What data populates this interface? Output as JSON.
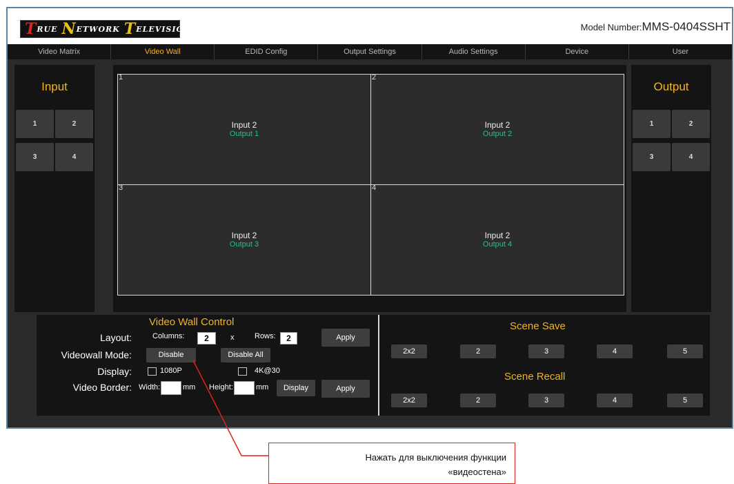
{
  "header": {
    "logo_text": "True Network Television",
    "model_label": "Model Number:",
    "model_value": "MMS-0404SSHT"
  },
  "nav": {
    "tabs": [
      {
        "label": "Video Matrix",
        "active": false
      },
      {
        "label": "Video Wall",
        "active": true
      },
      {
        "label": "EDID Config",
        "active": false
      },
      {
        "label": "Output Settings",
        "active": false
      },
      {
        "label": "Audio Settings",
        "active": false
      },
      {
        "label": "Device",
        "active": false
      },
      {
        "label": "User",
        "active": false
      }
    ]
  },
  "input_panel": {
    "title": "Input",
    "buttons": [
      "1",
      "2",
      "3",
      "4"
    ]
  },
  "output_panel": {
    "title": "Output",
    "buttons": [
      "1",
      "2",
      "3",
      "4"
    ]
  },
  "wall": {
    "cells": [
      {
        "number": "1",
        "input": "Input 2",
        "output": "Output 1"
      },
      {
        "number": "2",
        "input": "Input 2",
        "output": "Output 2"
      },
      {
        "number": "3",
        "input": "Input 2",
        "output": "Output 3"
      },
      {
        "number": "4",
        "input": "Input 2",
        "output": "Output 4"
      }
    ]
  },
  "control": {
    "title": "Video Wall Control",
    "layout_label": "Layout:",
    "columns_label": "Columns:",
    "columns_value": "2",
    "x_label": "x",
    "rows_label": "Rows:",
    "rows_value": "2",
    "apply_label": "Apply",
    "mode_label": "Videowall Mode:",
    "disable_label": "Disable",
    "disable_all_label": "Disable All",
    "display_label": "Display:",
    "opt_1080p": "1080P",
    "opt_4k30": "4K@30",
    "border_label": "Video Border:",
    "width_label": "Width:",
    "width_value": "",
    "mm_label": "mm",
    "height_label": "Height:",
    "height_value": "",
    "display_button": "Display",
    "apply2_label": "Apply"
  },
  "scene": {
    "save_title": "Scene Save",
    "recall_title": "Scene Recall",
    "save_buttons": [
      "2x2",
      "2",
      "3",
      "4",
      "5"
    ],
    "recall_buttons": [
      "2x2",
      "2",
      "3",
      "4",
      "5"
    ]
  },
  "annotation": {
    "line1": "Нажать для выключения функции",
    "line2": "«видеостена»"
  },
  "colors": {
    "accent": "#f0b428",
    "output_text": "#2ebf8e",
    "panel": "#141414",
    "annotation": "#e02020"
  }
}
